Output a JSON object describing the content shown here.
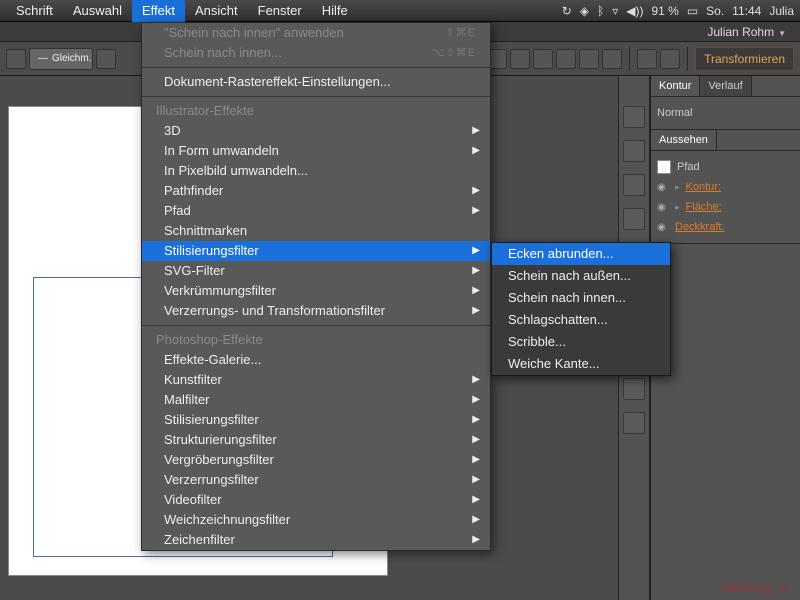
{
  "menubar": {
    "items": [
      "Schrift",
      "Auswahl",
      "Effekt",
      "Ansicht",
      "Fenster",
      "Hilfe"
    ],
    "active_index": 2,
    "sys": {
      "battery": "91 %",
      "day": "So.",
      "time": "11:44",
      "user": "Julia"
    }
  },
  "infobar": {
    "user": "Julian Rohm"
  },
  "controlbar": {
    "pill_label": "Gleichm.",
    "transform": "Transformieren"
  },
  "panels": {
    "tabs1": [
      "Kontur",
      "Verlauf"
    ],
    "normal": "Normal",
    "tabs2": [
      "Aussehen"
    ],
    "object": "Pfad",
    "rows": [
      {
        "label": "Kontur:"
      },
      {
        "label": "Fläche:"
      },
      {
        "label": "Deckkraft:"
      }
    ]
  },
  "dropdown": {
    "apply": "\"Schein nach innen\" anwenden",
    "apply_sc": "⇧⌘E",
    "last": "Schein nach innen...",
    "last_sc": "⌥⇧⌘E",
    "raster": "Dokument-Rastereffekt-Einstellungen...",
    "header1": "Illustrator-Effekte",
    "ill": [
      "3D",
      "In Form umwandeln",
      "In Pixelbild umwandeln...",
      "Pathfinder",
      "Pfad",
      "Schnittmarken",
      "Stilisierungsfilter",
      "SVG-Filter",
      "Verkrümmungsfilter",
      "Verzerrungs- und Transformationsfilter"
    ],
    "ill_arrows": [
      true,
      true,
      false,
      true,
      true,
      false,
      true,
      true,
      true,
      true
    ],
    "hl_index": 6,
    "header2": "Photoshop-Effekte",
    "ps": [
      "Effekte-Galerie...",
      "Kunstfilter",
      "Malfilter",
      "Stilisierungsfilter",
      "Strukturierungsfilter",
      "Vergröberungsfilter",
      "Verzerrungsfilter",
      "Videofilter",
      "Weichzeichnungsfilter",
      "Zeichenfilter"
    ],
    "ps_arrows": [
      false,
      true,
      true,
      true,
      true,
      true,
      true,
      true,
      true,
      true
    ]
  },
  "submenu": {
    "items": [
      "Ecken abrunden...",
      "Schein nach außen...",
      "Schein nach innen...",
      "Schlagschatten...",
      "Scribble...",
      "Weiche Kante..."
    ],
    "hl_index": 0
  },
  "bottom_label": "Abbildung_04"
}
